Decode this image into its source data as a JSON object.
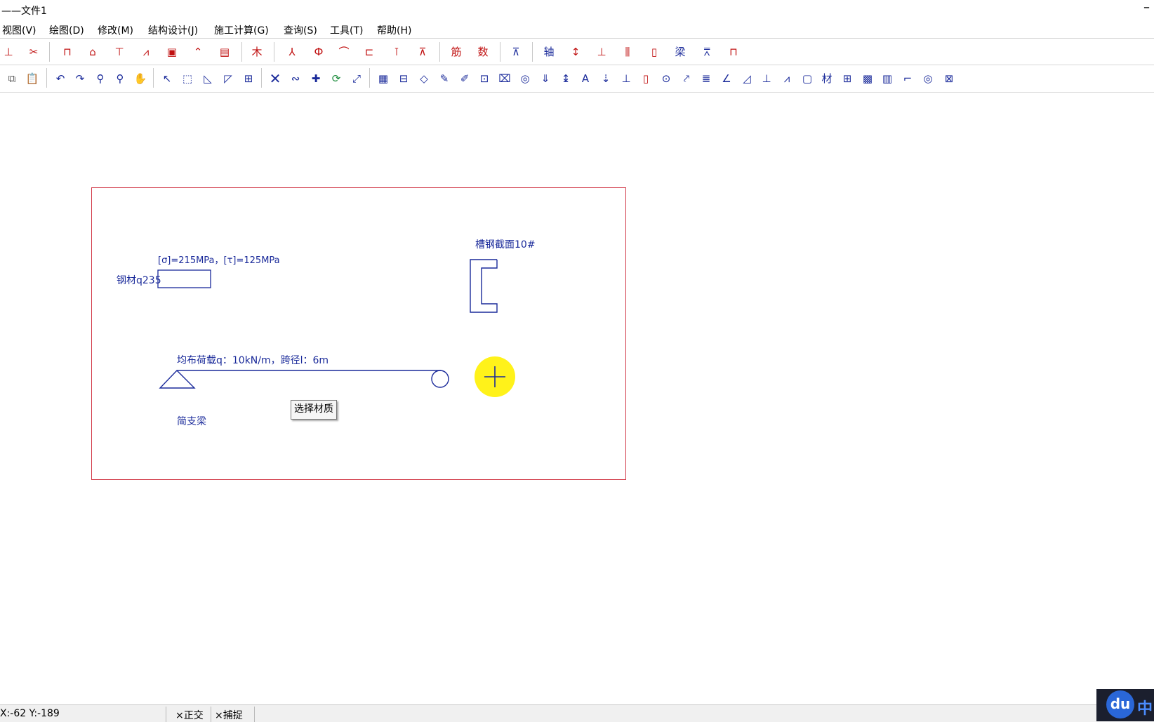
{
  "window": {
    "title": "——文件1",
    "minimize_glyph": "–"
  },
  "menu": [
    {
      "label": "视图(V)"
    },
    {
      "label": "绘图(D)"
    },
    {
      "label": "修改(M)"
    },
    {
      "label": "结构设计(J)"
    },
    {
      "label": "施工计算(G)"
    },
    {
      "label": "查询(S)"
    },
    {
      "label": "工具(T)"
    },
    {
      "label": "帮助(H)"
    }
  ],
  "toolbar1": {
    "icons": [
      "beam-support-icon",
      "scissor-tool-icon",
      "formwork-icon",
      "scaffold-icon",
      "tower-crane-icon",
      "trestle-icon",
      "frame-icon",
      "stair-icon",
      "slab-icon",
      "wood-icon",
      "axis-tool-icon",
      "column-icon",
      "arch-icon",
      "wall-icon",
      "pile-icon",
      "truss-icon",
      "rebar-icon",
      "number-icon",
      "dimension-icon",
      "axis-icon",
      "vertical-axis-icon",
      "column-axis-icon",
      "grid-icon",
      "bolt-icon",
      "beam-icon",
      "bridge-icon",
      "gantry-icon"
    ],
    "text_labels": {
      "wood": "木",
      "number": "数",
      "axis": "轴",
      "beam": "梁",
      "rebar": "筋"
    }
  },
  "toolbar2": {
    "icons": [
      "copy-icon",
      "paste-icon",
      "undo-icon",
      "redo-icon",
      "zoom-out-icon",
      "zoom-in-icon",
      "pan-icon",
      "select-icon",
      "window-select-icon",
      "scale-icon",
      "mirror-icon",
      "block-icon",
      "delete-icon",
      "join-icon",
      "move-icon",
      "rotate-icon",
      "array-icon",
      "hatch-icon",
      "table-icon",
      "diamond-icon",
      "pencil-icon",
      "edit-icon",
      "steel-icon",
      "region-icon",
      "ring-icon",
      "arrow-down-icon",
      "dim-vertical-icon",
      "text-icon",
      "load-icon",
      "support-icon",
      "rect-icon",
      "circle-icon",
      "leader-icon",
      "lines-icon",
      "angle-icon",
      "triangle-icon",
      "node-icon",
      "polyline-icon",
      "box-icon",
      "material-icon",
      "window-icon",
      "pattern-icon",
      "sheet-icon",
      "line-icon",
      "target-icon",
      "dimension-text-icon"
    ],
    "text_labels": {
      "material": "材",
      "text": "A"
    }
  },
  "drawing": {
    "stress_label": "[σ]=215MPa，[τ]=125MPa",
    "material_label": "钢材q235",
    "section_label": "槽钢截面10#",
    "load_label": "均布荷载q：10kN/m，跨径l：6m",
    "beam_type_label": "简支梁",
    "tooltip": "选择材质",
    "stroke_color": "#1a2a9a",
    "frame_color": "#d23c4a"
  },
  "cursor": {
    "highlight_color": "#fff21a"
  },
  "status": {
    "coords": "X:-62  Y:-189",
    "ortho": "×正交",
    "snap": "×捕捉"
  },
  "ime": {
    "logo": "du",
    "language": "中"
  }
}
